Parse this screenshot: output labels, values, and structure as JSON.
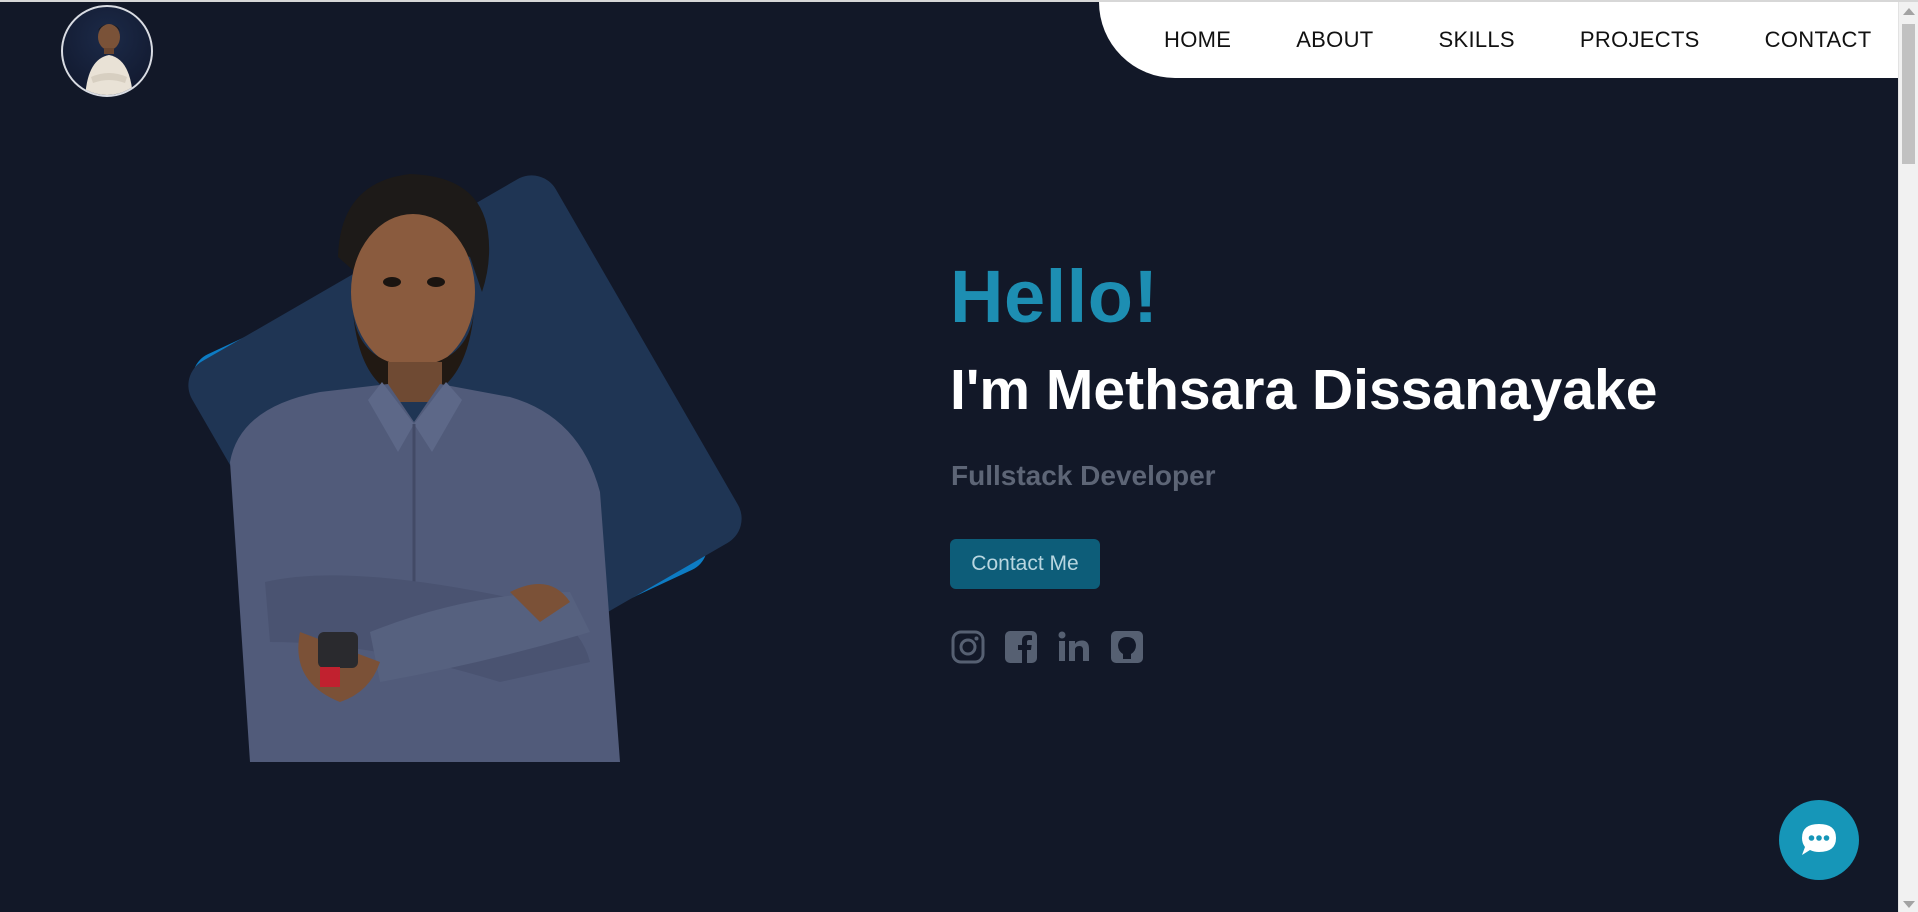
{
  "nav": {
    "items": [
      {
        "label": "HOME"
      },
      {
        "label": "ABOUT"
      },
      {
        "label": "SKILLS"
      },
      {
        "label": "PROJECTS"
      },
      {
        "label": "CONTACT"
      }
    ]
  },
  "hero": {
    "greeting": "Hello!",
    "name": "I'm Methsara Dissanayake",
    "role": "Fullstack Developer",
    "cta_label": "Contact Me"
  },
  "socials": [
    {
      "icon": "instagram-icon"
    },
    {
      "icon": "facebook-icon"
    },
    {
      "icon": "linkedin-icon"
    },
    {
      "icon": "github-icon"
    }
  ],
  "colors": {
    "background": "#121828",
    "accent": "#1d8eb2",
    "button": "#0d5d79",
    "card_blue": "#0d7cc4",
    "card_navy": "#1f3554",
    "muted_text": "#5d6576"
  }
}
